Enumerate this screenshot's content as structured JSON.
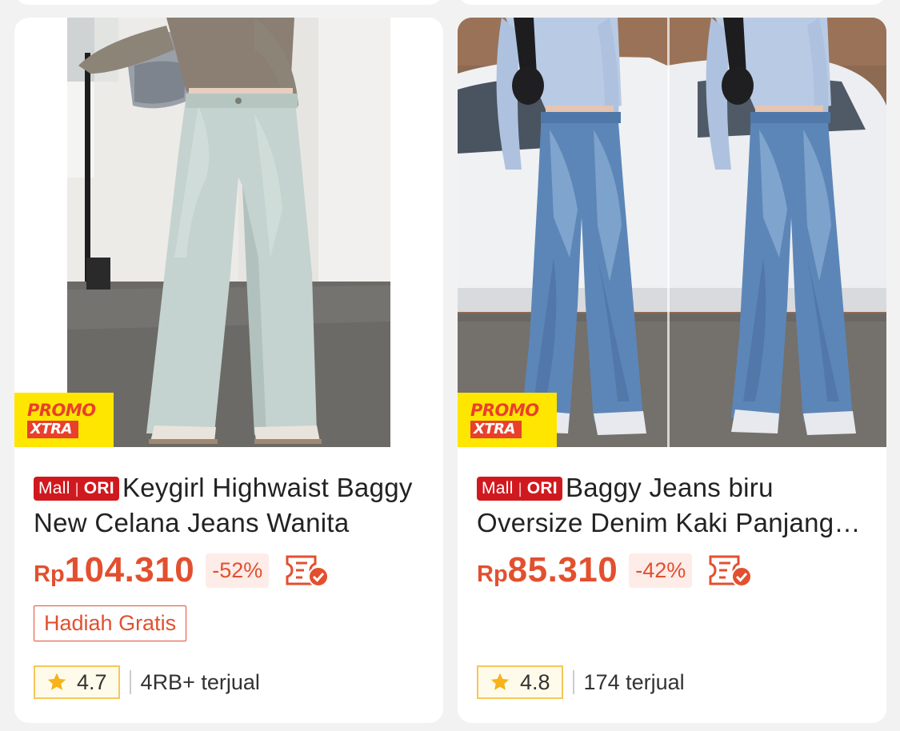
{
  "products": [
    {
      "promo_line1": "PROMO",
      "promo_line2": "XTRA",
      "mall_label": "Mall",
      "ori_label": "ORI",
      "title": "Keygirl Highwaist Baggy New Celana Jeans Wanita",
      "currency": "Rp",
      "price": "104.310",
      "discount": "-52%",
      "gift": "Hadiah Gratis",
      "rating": "4.7",
      "sold": "4RB+ terjual",
      "image": "light-wash-wide-leg-jeans-photo"
    },
    {
      "promo_line1": "PROMO",
      "promo_line2": "XTRA",
      "mall_label": "Mall",
      "ori_label": "ORI",
      "title": "Baggy Jeans biru Oversize Denim Kaki Panjang Wanita",
      "currency": "Rp",
      "price": "85.310",
      "discount": "-42%",
      "gift": "",
      "rating": "4.8",
      "sold": "174 terjual",
      "image": "blue-baggy-jeans-photo"
    }
  ],
  "colors": {
    "accent": "#e2502f",
    "mall_red": "#d0191f",
    "promo_yellow": "#ffe600",
    "rating_border": "#f5c65a",
    "page_bg": "#f2f2f2"
  },
  "icons": [
    "star-icon",
    "voucher-check-icon"
  ]
}
